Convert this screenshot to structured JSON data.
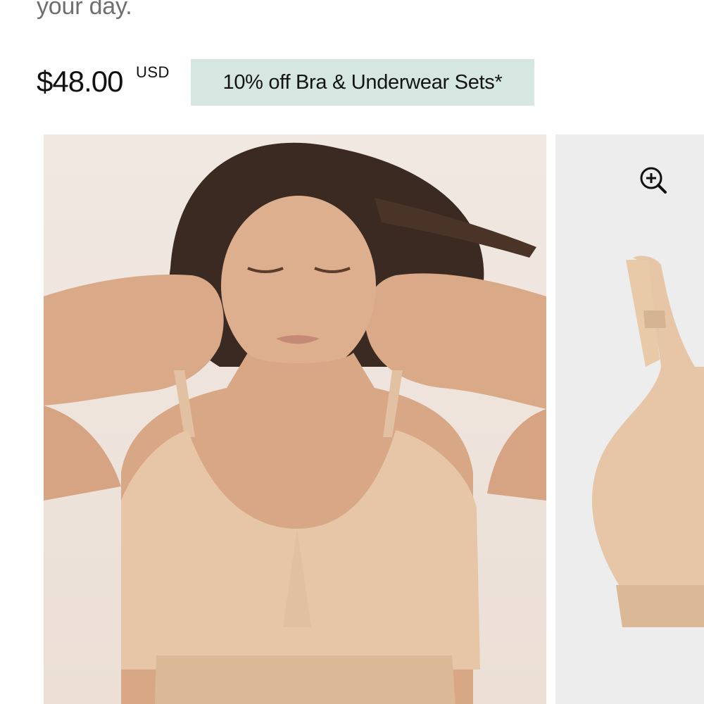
{
  "product": {
    "description_tail": "your day.",
    "price": "$48.00",
    "currency": "USD",
    "promo_label": "10% off Bra & Underwear Sets*"
  },
  "gallery": {
    "slides": [
      {
        "name": "model-photo"
      },
      {
        "name": "product-photo"
      }
    ],
    "zoom_icon": "zoom-in-icon"
  },
  "colors": {
    "promo_background": "#d6e6e0",
    "product_color": "#e6c6a6",
    "product_slide_background": "#ededed"
  }
}
